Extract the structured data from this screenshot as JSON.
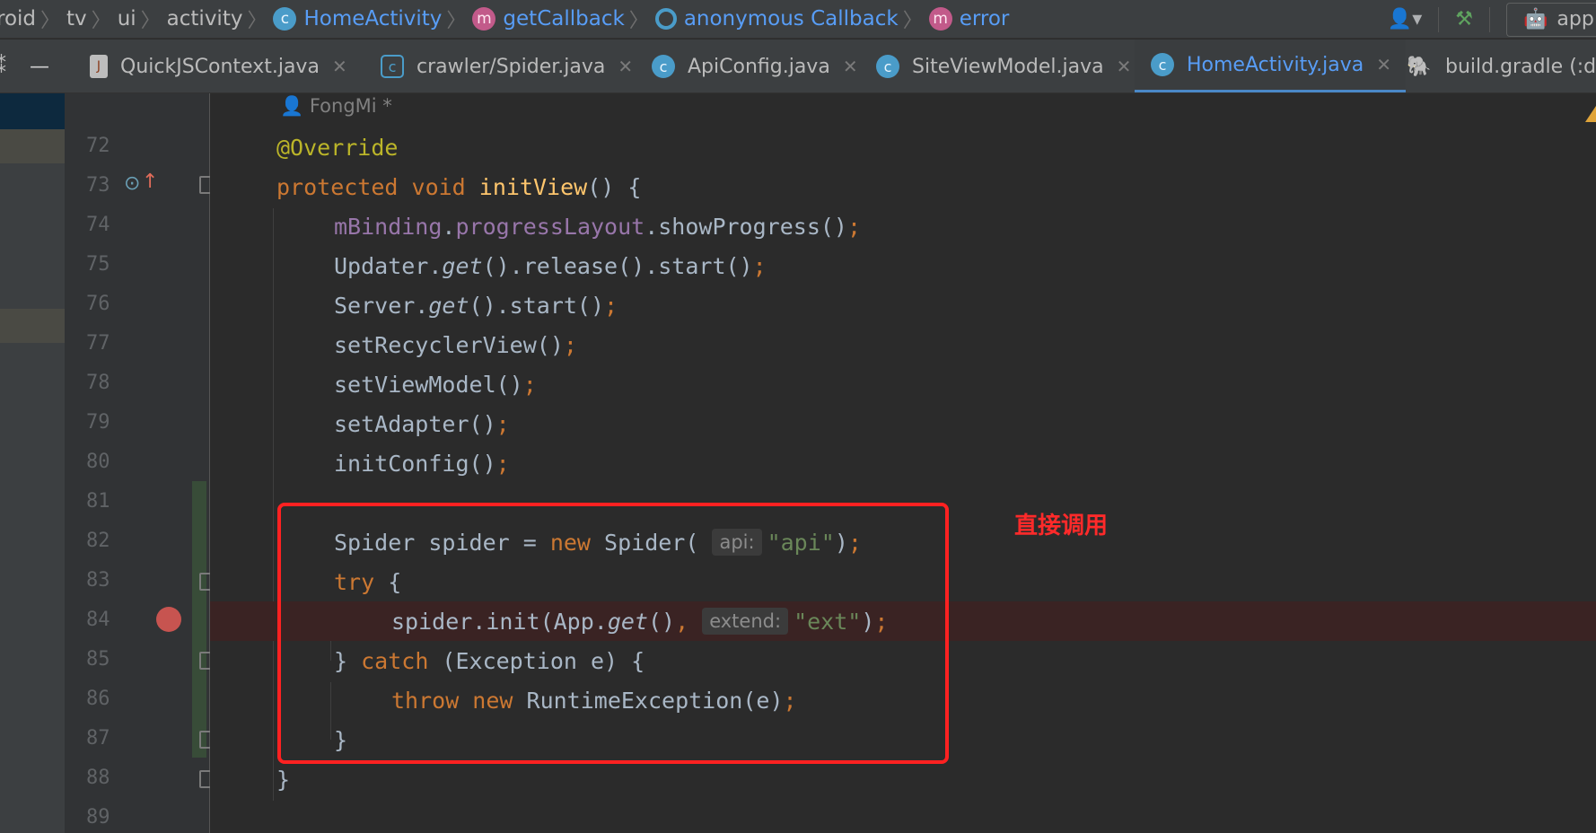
{
  "breadcrumb": {
    "items": [
      {
        "label": "roid",
        "icon": ""
      },
      {
        "label": "tv",
        "icon": ""
      },
      {
        "label": "ui",
        "icon": ""
      },
      {
        "label": "activity",
        "icon": ""
      },
      {
        "label": "HomeActivity",
        "icon": "class-icon"
      },
      {
        "label": "getCallback",
        "icon": "method-icon"
      },
      {
        "label": "anonymous Callback",
        "icon": "anonymous-class-icon"
      },
      {
        "label": "error",
        "icon": "method-icon"
      }
    ],
    "run_config": "app"
  },
  "tabs": [
    {
      "label": "QuickJSContext.java",
      "icon": "java-file-icon",
      "active": false
    },
    {
      "label": "crawler/Spider.java",
      "icon": "class-icon",
      "active": false
    },
    {
      "label": "ApiConfig.java",
      "icon": "class-icon",
      "active": false
    },
    {
      "label": "SiteViewModel.java",
      "icon": "class-icon",
      "active": false
    },
    {
      "label": "HomeActivity.java",
      "icon": "class-icon",
      "active": true
    },
    {
      "label": "build.gradle (:drp",
      "icon": "gradle-icon",
      "active": false
    }
  ],
  "editor": {
    "author": "FongMi *",
    "line_numbers": [
      "72",
      "73",
      "74",
      "75",
      "76",
      "77",
      "78",
      "79",
      "80",
      "81",
      "82",
      "83",
      "84",
      "85",
      "86",
      "87",
      "88",
      "89"
    ],
    "hints": {
      "api": "api:",
      "extend": "extend:"
    },
    "strings": {
      "api": "\"api\"",
      "ext": "\"ext\""
    },
    "breakpoint_line": "84"
  },
  "annotation": {
    "text": "直接调用",
    "color": "#ff2a2a"
  },
  "colors": {
    "keyword": "#cc7832",
    "annotation": "#bbb529",
    "method": "#ffc66d",
    "field": "#9876aa",
    "string": "#6a8759",
    "accent": "#589df6"
  }
}
